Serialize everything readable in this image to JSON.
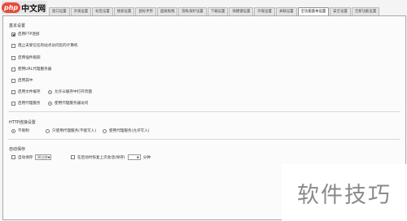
{
  "logo": {
    "php": "php",
    "cn": "中文网"
  },
  "tabs": [
    {
      "label": "窗口设置"
    },
    {
      "label": "外观设置"
    },
    {
      "label": "标签设置"
    },
    {
      "label": "搜索设置"
    },
    {
      "label": "鼠标手势"
    },
    {
      "label": "超级拖拽"
    },
    {
      "label": "隐私保护设置"
    },
    {
      "label": "下载设置"
    },
    {
      "label": "快捷键设置"
    },
    {
      "label": "外观设置"
    },
    {
      "label": "关联设置"
    },
    {
      "label": "全功能基本设置"
    },
    {
      "label": "安全设置"
    },
    {
      "label": "全新功能设置"
    }
  ],
  "active_tab_index": 11,
  "section1": {
    "title": "基本设置",
    "items": [
      {
        "label": "启用FTP连接",
        "checked": true
      },
      {
        "label": "阻止未受信任的站点访问您的计算机",
        "checked": false
      },
      {
        "label": "启用插件跟踪",
        "checked": false
      },
      {
        "label": "使用URL代理服务器",
        "checked": false
      },
      {
        "label": "启用其中",
        "checked": false
      }
    ],
    "pair1": {
      "cb_label": "启用文件缓存",
      "checked": false,
      "rb_label": "允许从缓存中打开页面",
      "rb_checked": true
    },
    "pair2": {
      "cb_label": "启用代理服务",
      "checked": false,
      "rb_label": "使用代理服务器访问",
      "rb_checked": true
    }
  },
  "section2": {
    "title": "HTTP连接设置",
    "options": [
      {
        "label": "不限制",
        "checked": true
      },
      {
        "label": "只使用代理服务(不能写入)",
        "checked": false
      },
      {
        "label": "使用代理服务(允许写入)",
        "checked": false
      }
    ]
  },
  "section3": {
    "title": "自动保存",
    "autosave_label": "自动保存",
    "autosave_checked": false,
    "autosave_select": "30分钟",
    "recover_label": "在启动时恢复上次会话(保存)",
    "recover_checked": false,
    "recover_select": "",
    "unit": "分钟"
  },
  "watermark": "软件技巧"
}
